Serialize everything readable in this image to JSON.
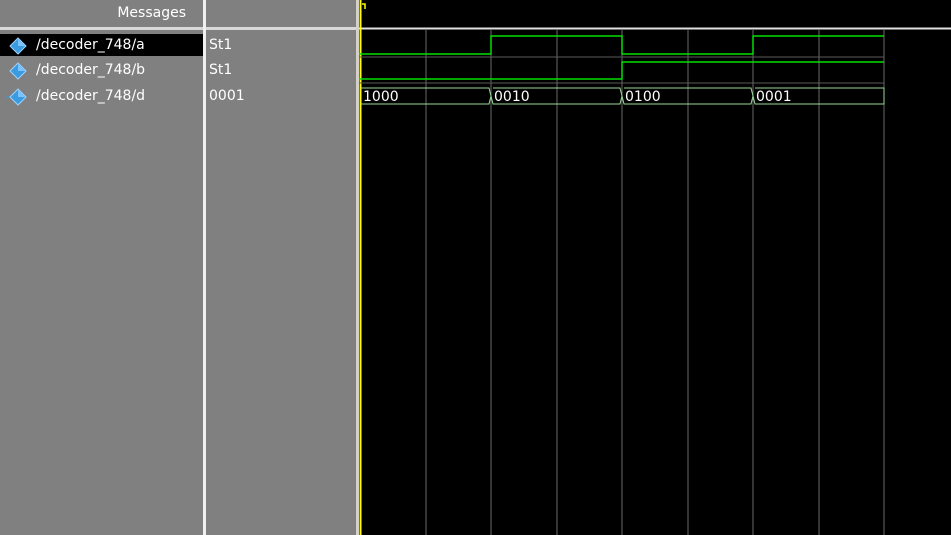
{
  "header": {
    "messages_label": "Messages"
  },
  "signals": [
    {
      "name": "/decoder_748/a",
      "value": "St1",
      "selected": true
    },
    {
      "name": "/decoder_748/b",
      "value": "St1",
      "selected": false
    },
    {
      "name": "/decoder_748/d",
      "value": "0001",
      "selected": false
    }
  ],
  "bus_values": [
    "1000",
    "0010",
    "0100",
    "0001"
  ],
  "colors": {
    "pane_background": "#808080",
    "wave_background": "#000000",
    "waveform": "#00e000",
    "bus_waveform": "#9ad89a",
    "grid": "#6a6a6a",
    "cursor": "#ffff00",
    "signal_icon": "#3a9be0"
  }
}
